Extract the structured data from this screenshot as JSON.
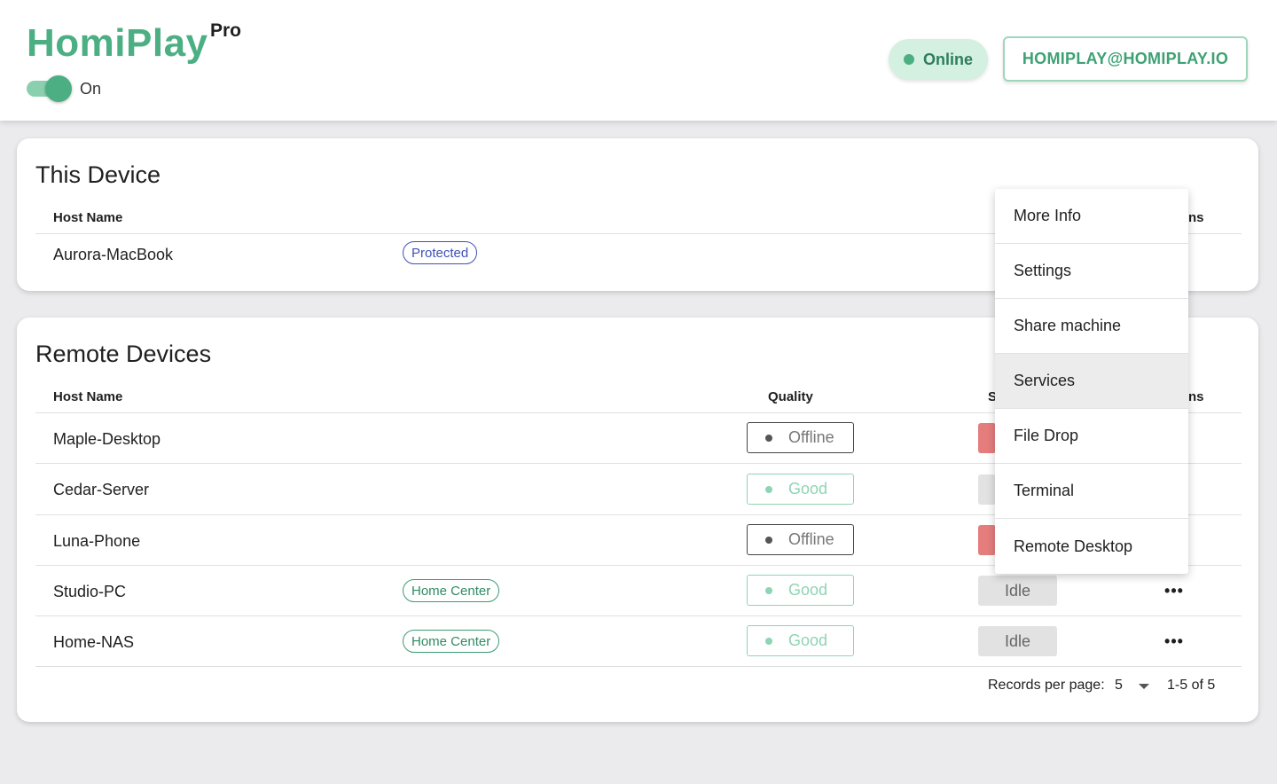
{
  "header": {
    "brand": "HomiPlay",
    "badge": "Pro",
    "toggle_label": "On",
    "toggle_on": true,
    "status": "Online",
    "account_email": "HOMIPLAY@HOMIPLAY.IO"
  },
  "this_device": {
    "title": "This Device",
    "columns": {
      "host_name": "Host Name",
      "actions_tail": "ns"
    },
    "row": {
      "host": "Aurora-MacBook",
      "tag": "Protected"
    }
  },
  "remote_devices": {
    "title": "Remote Devices",
    "columns": {
      "host_name": "Host Name",
      "quality": "Quality",
      "status_head": "S",
      "actions_tail": "ns"
    },
    "rows": [
      {
        "host": "Maple-Desktop",
        "tag": "",
        "quality": "Offline",
        "status": ""
      },
      {
        "host": "Cedar-Server",
        "tag": "",
        "quality": "Good",
        "status": ""
      },
      {
        "host": "Luna-Phone",
        "tag": "",
        "quality": "Offline",
        "status": ""
      },
      {
        "host": "Studio-PC",
        "tag": "Home Center",
        "quality": "Good",
        "status": "Idle",
        "more": "•••"
      },
      {
        "host": "Home-NAS",
        "tag": "Home Center",
        "quality": "Good",
        "status": "Idle",
        "more": "•••"
      }
    ],
    "pagination": {
      "label": "Records per page:",
      "per_page": "5",
      "range": "1-5 of 5"
    }
  },
  "context_menu": {
    "items": [
      "More Info",
      "Settings",
      "Share machine",
      "Services",
      "File Drop",
      "Terminal",
      "Remote Desktop"
    ],
    "highlighted": "Services"
  },
  "colors": {
    "brand_green": "#4caf83",
    "online_bg": "#d3f0e1",
    "offline_red": "#e57d7d",
    "protected_blue": "#3f51b5"
  }
}
